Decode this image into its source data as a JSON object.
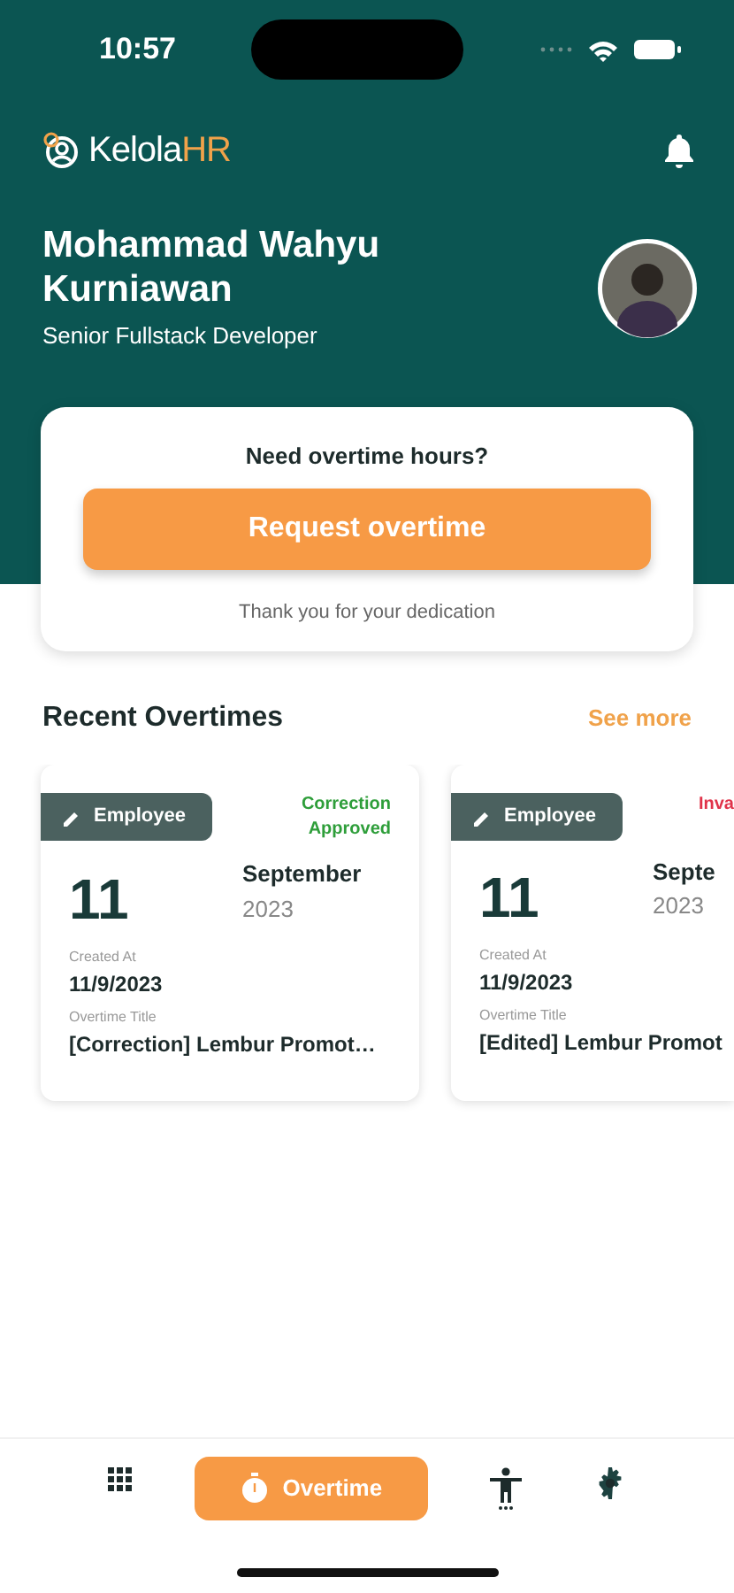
{
  "status_bar": {
    "time": "10:57"
  },
  "header": {
    "logo": {
      "main": "Kelola",
      "accent": "HR"
    },
    "user": {
      "name": "Mohammad Wahyu Kurniawan",
      "role": "Senior Fullstack Developer"
    }
  },
  "request_card": {
    "question": "Need overtime hours?",
    "button": "Request overtime",
    "note": "Thank you for your dedication"
  },
  "recent": {
    "title": "Recent Overtimes",
    "see_more": "See more",
    "items": [
      {
        "role": "Employee",
        "status": "Correction Approved",
        "color": "#2e9e3a",
        "day": "11",
        "month": "September",
        "year": "2023",
        "created_label": "Created At",
        "created": "11/9/2023",
        "title_label": "Overtime Title",
        "title": "[Correction] Lembur Promot…"
      },
      {
        "role": "Employee",
        "status": "Inva",
        "color": "#e0334a",
        "day": "11",
        "month": "Septe",
        "year": "2023",
        "created_label": "Created At",
        "created": "11/9/2023",
        "title_label": "Overtime Title",
        "title": "[Edited] Lembur Promot"
      }
    ]
  },
  "bottom_nav": [
    {
      "kind": "grid",
      "selected": false
    },
    {
      "kind": "stopwatch",
      "label": "Overtime",
      "selected": true
    },
    {
      "kind": "person",
      "selected": false
    },
    {
      "kind": "gear",
      "selected": false
    }
  ]
}
